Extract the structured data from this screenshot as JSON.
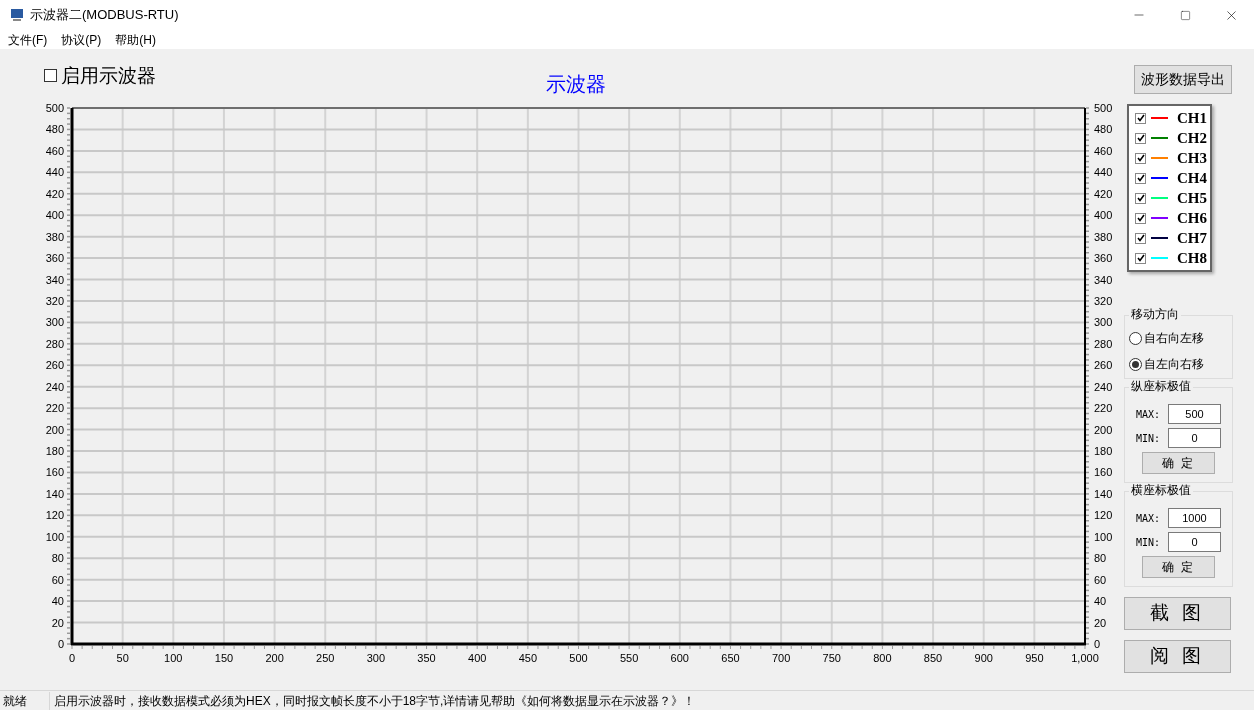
{
  "window": {
    "title": "示波器二(MODBUS-RTU)"
  },
  "menu": [
    "文件(F)",
    "协议(P)",
    "帮助(H)"
  ],
  "enable": {
    "label": "启用示波器",
    "checked": false
  },
  "chart_data": {
    "type": "line",
    "title": "示波器",
    "xlim": [
      0,
      1000
    ],
    "ylim": [
      0,
      500
    ],
    "xticks": [
      0,
      50,
      100,
      150,
      200,
      250,
      300,
      350,
      400,
      450,
      500,
      550,
      600,
      650,
      700,
      750,
      800,
      850,
      900,
      950,
      {
        "value": 1000,
        "label": "1,000"
      }
    ],
    "yticks": [
      0,
      20,
      40,
      60,
      80,
      100,
      120,
      140,
      160,
      180,
      200,
      220,
      240,
      260,
      280,
      300,
      320,
      340,
      360,
      380,
      400,
      420,
      440,
      460,
      480,
      500
    ],
    "y2ticks": [
      0,
      20,
      40,
      60,
      80,
      100,
      120,
      140,
      160,
      180,
      200,
      220,
      240,
      260,
      280,
      300,
      320,
      340,
      360,
      380,
      400,
      420,
      440,
      460,
      480,
      500
    ],
    "y2lim": [
      0,
      500
    ],
    "grid": true
  },
  "export_button": "波形数据导出",
  "channels": [
    {
      "name": "CH1",
      "color": "#ff0000",
      "checked": true
    },
    {
      "name": "CH2",
      "color": "#008000",
      "checked": true
    },
    {
      "name": "CH3",
      "color": "#ff8000",
      "checked": true
    },
    {
      "name": "CH4",
      "color": "#0000ff",
      "checked": true
    },
    {
      "name": "CH5",
      "color": "#00ff80",
      "checked": true
    },
    {
      "name": "CH6",
      "color": "#8000ff",
      "checked": true
    },
    {
      "name": "CH7",
      "color": "#000040",
      "checked": true
    },
    {
      "name": "CH8",
      "color": "#00ffff",
      "checked": true
    }
  ],
  "direction": {
    "title": "移动方向",
    "options": [
      {
        "label": "自右向左移",
        "selected": false
      },
      {
        "label": "自左向右移",
        "selected": true
      }
    ]
  },
  "y_range": {
    "title": "纵座标极值",
    "max_label": "MAX:",
    "max": "500",
    "min_label": "MIN:",
    "min": "0",
    "button": "确 定"
  },
  "x_range": {
    "title": "横座标极值",
    "max_label": "MAX:",
    "max": "1000",
    "min_label": "MIN:",
    "min": "0",
    "button": "确 定"
  },
  "action_buttons": [
    "截 图",
    "阅 图"
  ],
  "status_bar": [
    "就绪",
    "启用示波器时，接收数据模式必须为HEX，同时报文帧长度不小于18字节,详情请见帮助《如何将数据显示在示波器？》！"
  ]
}
